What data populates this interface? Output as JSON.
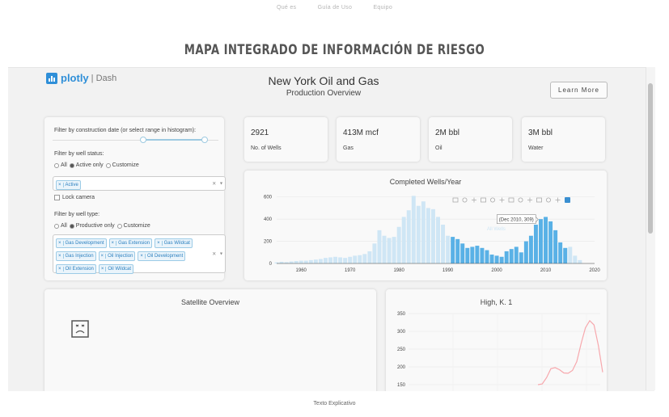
{
  "nav": {
    "items": [
      "Qué es",
      "Guía de Uso",
      "Equipo"
    ]
  },
  "page_title": "MAPA INTEGRADO DE INFORMACIÓN DE RIESGO",
  "app": {
    "logo_text": "plotly",
    "logo_suffix": "Dash",
    "title": "New York Oil and Gas",
    "subtitle": "Production Overview",
    "learn_more": "Learn More"
  },
  "filters": {
    "date_label": "Filter by construction date (or select range in histogram):",
    "status_label": "Filter by well status:",
    "status_options": [
      "All",
      "Active only",
      "Customize"
    ],
    "status_selected": "Active only",
    "status_tags": [
      "Active"
    ],
    "lock_camera": "Lock camera",
    "type_label": "Filter by well type:",
    "type_options": [
      "All",
      "Productive only",
      "Customize"
    ],
    "type_selected": "Productive only",
    "type_tags": [
      "Gas Development",
      "Gas Extension",
      "Gas Wildcat",
      "Gas Injection",
      "Oil Injection",
      "Oil Development",
      "Oil Extension",
      "Oil Wildcat"
    ],
    "clear_symbol": "×",
    "arrow_symbol": "▾",
    "tag_remove_symbol": "×"
  },
  "stats": [
    {
      "value": "2921",
      "caption": "No. of Wells"
    },
    {
      "value": "413M mcf",
      "caption": "Gas"
    },
    {
      "value": "2M bbl",
      "caption": "Oil"
    },
    {
      "value": "3M bbl",
      "caption": "Water"
    }
  ],
  "count_graph": {
    "title": "Completed Wells/Year",
    "hover_label": "(Dec 2010, 309)",
    "faint_label": "All Wells",
    "modebar_icons": [
      "camera-icon",
      "zoom-icon",
      "pan-icon",
      "box-select-icon",
      "lasso-icon",
      "zoom-in-icon",
      "zoom-out-icon",
      "autoscale-icon",
      "reset-axes-icon",
      "spike-lines-icon",
      "hover-closest-icon",
      "hover-compare-icon",
      "plotly-logo-icon"
    ]
  },
  "satellite": {
    "title": "Satellite Overview"
  },
  "individual": {
    "title": "High, K. 1"
  },
  "footer_text": "Texto Explicativo",
  "colors": {
    "accent": "#2f8fd8",
    "bar_selected": "#59b1e6",
    "bar_unselected": "#cfe6f5",
    "line": "#f7a8ad"
  },
  "chart_data": [
    {
      "type": "bar",
      "title": "Completed Wells/Year",
      "xlim": [
        1955,
        2020
      ],
      "ylim": [
        0,
        620
      ],
      "xticks": [
        1960,
        1970,
        1980,
        1990,
        2000,
        2010,
        2020
      ],
      "yticks": [
        0,
        200,
        400,
        600
      ],
      "selected_range": [
        1991,
        2014
      ],
      "x": [
        1955,
        1956,
        1957,
        1958,
        1959,
        1960,
        1961,
        1962,
        1963,
        1964,
        1965,
        1966,
        1967,
        1968,
        1969,
        1970,
        1971,
        1972,
        1973,
        1974,
        1975,
        1976,
        1977,
        1978,
        1979,
        1980,
        1981,
        1982,
        1983,
        1984,
        1985,
        1986,
        1987,
        1988,
        1989,
        1990,
        1991,
        1992,
        1993,
        1994,
        1995,
        1996,
        1997,
        1998,
        1999,
        2000,
        2001,
        2002,
        2003,
        2004,
        2005,
        2006,
        2007,
        2008,
        2009,
        2010,
        2011,
        2012,
        2013,
        2014,
        2015,
        2016,
        2017
      ],
      "values": [
        10,
        15,
        12,
        18,
        22,
        25,
        25,
        30,
        35,
        40,
        50,
        55,
        60,
        55,
        50,
        60,
        70,
        75,
        85,
        110,
        180,
        300,
        250,
        230,
        240,
        330,
        420,
        480,
        610,
        520,
        560,
        500,
        490,
        420,
        350,
        250,
        240,
        220,
        180,
        140,
        150,
        160,
        140,
        120,
        80,
        70,
        60,
        110,
        130,
        150,
        100,
        200,
        250,
        350,
        400,
        420,
        380,
        300,
        190,
        140,
        150,
        70,
        30
      ],
      "hover": {
        "x": "Dec 2010",
        "y": 309
      }
    },
    {
      "type": "line",
      "title": "High, K. 1",
      "ylim": [
        150,
        350
      ],
      "yticks": [
        150,
        200,
        250,
        300,
        350
      ],
      "x": [
        0,
        1,
        2,
        3,
        4,
        5,
        6,
        7,
        8,
        9,
        10,
        11,
        12,
        13,
        14,
        15
      ],
      "values": [
        150,
        152,
        170,
        195,
        198,
        192,
        183,
        182,
        190,
        215,
        265,
        310,
        330,
        318,
        260,
        185
      ]
    }
  ]
}
